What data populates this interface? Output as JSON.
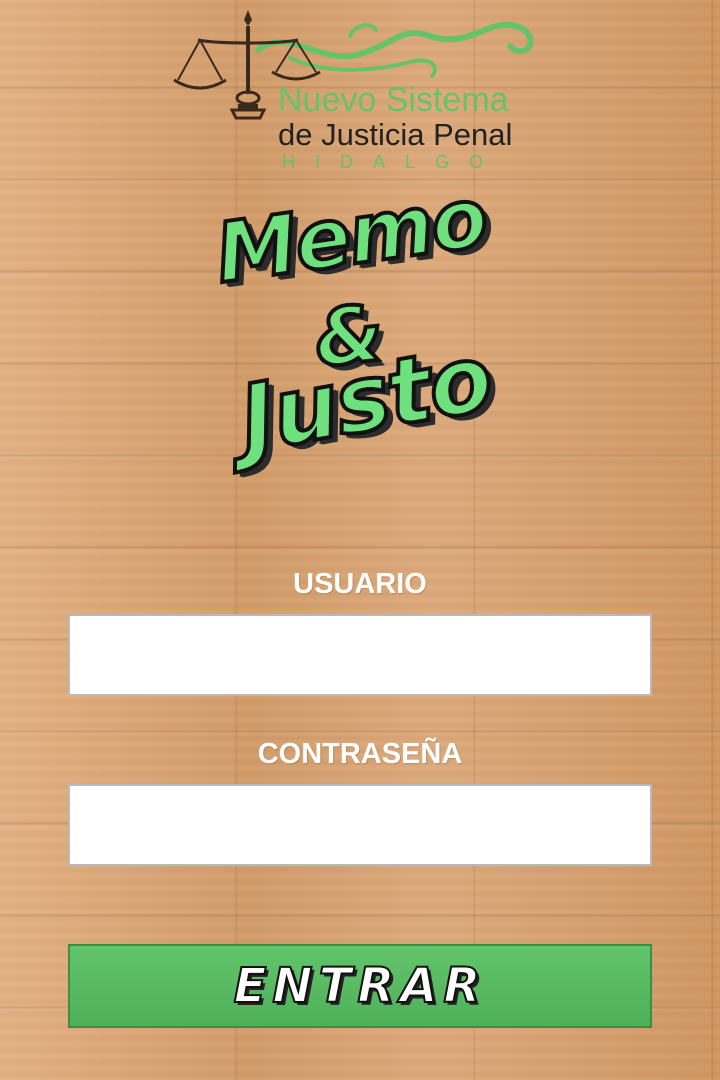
{
  "logo": {
    "line1": "Nuevo Sistema",
    "line2": "de Justicia Penal",
    "line3": "HIDALGO",
    "accent_color": "#67c26a",
    "icon": "scales-of-justice-icon"
  },
  "title": {
    "word1": "Memo",
    "amp": "&",
    "word2": "Justo",
    "fill_color": "#6ee07d"
  },
  "form": {
    "user_label": "USUARIO",
    "user_value": "",
    "password_label": "CONTRASEÑA",
    "password_value": "",
    "submit_label": "ENTRAR",
    "button_color": "#56b760"
  }
}
